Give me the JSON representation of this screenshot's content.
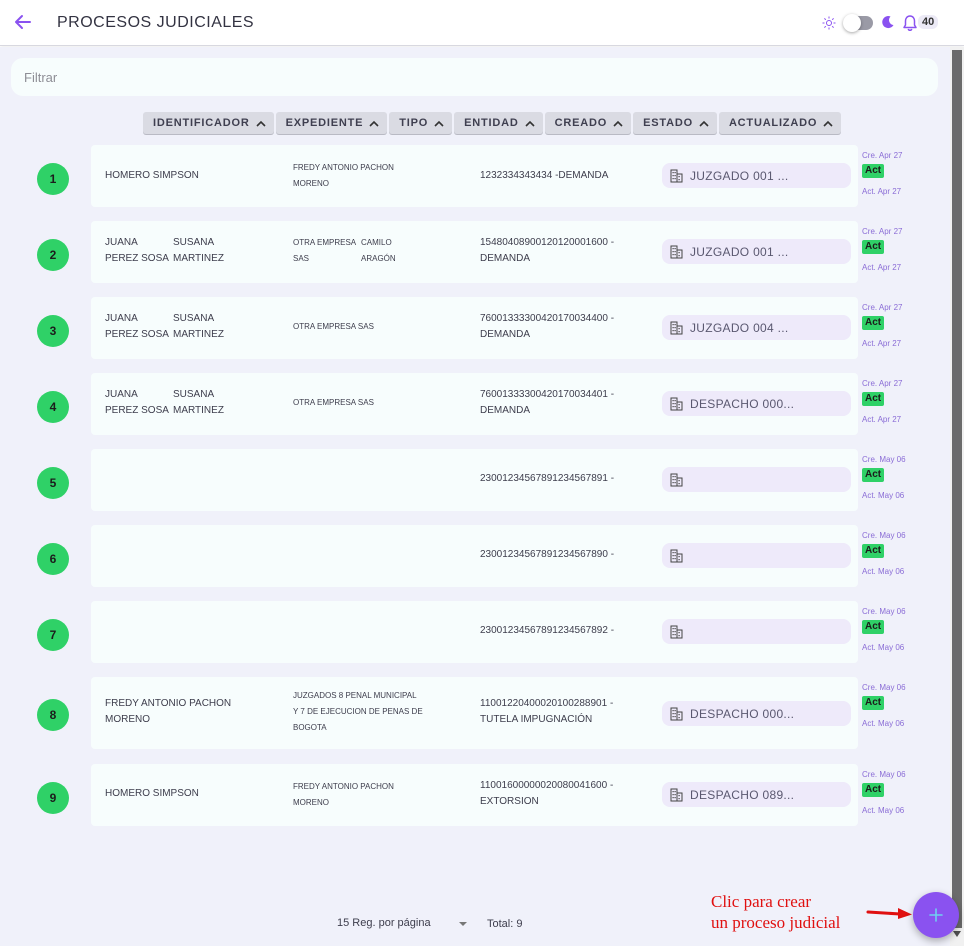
{
  "header": {
    "title": "PROCESOS JUDICIALES",
    "notification_count": "40",
    "accent_color": "#8a52f0"
  },
  "filter": {
    "placeholder": "Filtrar",
    "value": ""
  },
  "sort_columns": [
    "IDENTIFICADOR",
    "EXPEDIENTE",
    "TIPO",
    "ENTIDAD",
    "CREADO",
    "ESTADO",
    "ACTUALIZADO"
  ],
  "rows": [
    {
      "num": "1",
      "demandante": [
        "HOMERO SIMPSON"
      ],
      "demandados": [
        "FREDY ANTONIO PACHON",
        "MORENO"
      ],
      "expediente": [
        "1232334343434 -DEMANDA"
      ],
      "juzgado": "JUZGADO 001 ...",
      "creado": "Cre. Apr 27",
      "estado": "Act",
      "actualizado": "Act. Apr 27"
    },
    {
      "num": "2",
      "demandante_a": [
        "JUANA",
        "PEREZ SOSA"
      ],
      "demandante_b": [
        "SUSANA",
        "MARTINEZ"
      ],
      "demandado_a": [
        "OTRA EMPRESA",
        "SAS"
      ],
      "demandado_b": [
        "CAMILO",
        "ARAGÓN"
      ],
      "expediente": [
        "15480408900120120001600 -",
        "DEMANDA"
      ],
      "juzgado": "JUZGADO 001 ...",
      "creado": "Cre. Apr 27",
      "estado": "Act",
      "actualizado": "Act. Apr 27"
    },
    {
      "num": "3",
      "demandante_a": [
        "JUANA",
        "PEREZ SOSA"
      ],
      "demandante_b": [
        "SUSANA",
        "MARTINEZ"
      ],
      "demandados": [
        "OTRA EMPRESA SAS"
      ],
      "expediente": [
        "76001333300420170034400 -",
        "DEMANDA"
      ],
      "juzgado": "JUZGADO 004 ...",
      "creado": "Cre. Apr 27",
      "estado": "Act",
      "actualizado": "Act. Apr 27"
    },
    {
      "num": "4",
      "demandante_a": [
        "JUANA",
        "PEREZ SOSA"
      ],
      "demandante_b": [
        "SUSANA",
        "MARTINEZ"
      ],
      "demandados": [
        "OTRA EMPRESA SAS"
      ],
      "expediente": [
        "76001333300420170034401 -",
        "DEMANDA"
      ],
      "juzgado": "DESPACHO 000...",
      "creado": "Cre. Apr 27",
      "estado": "Act",
      "actualizado": "Act. Apr 27"
    },
    {
      "num": "5",
      "expediente": [
        "23001234567891234567891 -"
      ],
      "juzgado": "",
      "creado": "Cre. May 06",
      "estado": "Act",
      "actualizado": "Act. May 06"
    },
    {
      "num": "6",
      "expediente": [
        "23001234567891234567890 -"
      ],
      "juzgado": "",
      "creado": "Cre. May 06",
      "estado": "Act",
      "actualizado": "Act. May 06"
    },
    {
      "num": "7",
      "expediente": [
        "23001234567891234567892 -"
      ],
      "juzgado": "",
      "creado": "Cre. May 06",
      "estado": "Act",
      "actualizado": "Act. May 06"
    },
    {
      "num": "8",
      "demandante": [
        "FREDY ANTONIO PACHON",
        "MORENO"
      ],
      "demandados": [
        "JUZGADOS 8 PENAL MUNICIPAL",
        "Y 7 DE EJECUCION DE PENAS DE",
        "BOGOTA"
      ],
      "expediente": [
        "11001220400020100288901 -",
        "TUTELA IMPUGNACIÓN"
      ],
      "juzgado": "DESPACHO 000...",
      "creado": "Cre. May 06",
      "estado": "Act",
      "actualizado": "Act. May 06"
    },
    {
      "num": "9",
      "demandante": [
        "HOMERO SIMPSON"
      ],
      "demandados": [
        "FREDY ANTONIO PACHON",
        "MORENO"
      ],
      "expediente": [
        "11001600000020080041600 -",
        "EXTORSION"
      ],
      "juzgado": "DESPACHO 089...",
      "creado": "Cre. May 06",
      "estado": "Act",
      "actualizado": "Act. May 06"
    }
  ],
  "footer": {
    "per_page": "15 Reg. por página",
    "total": "Total: 9"
  },
  "annotation": {
    "line1": "Clic para crear",
    "line2": "un proceso judicial"
  }
}
